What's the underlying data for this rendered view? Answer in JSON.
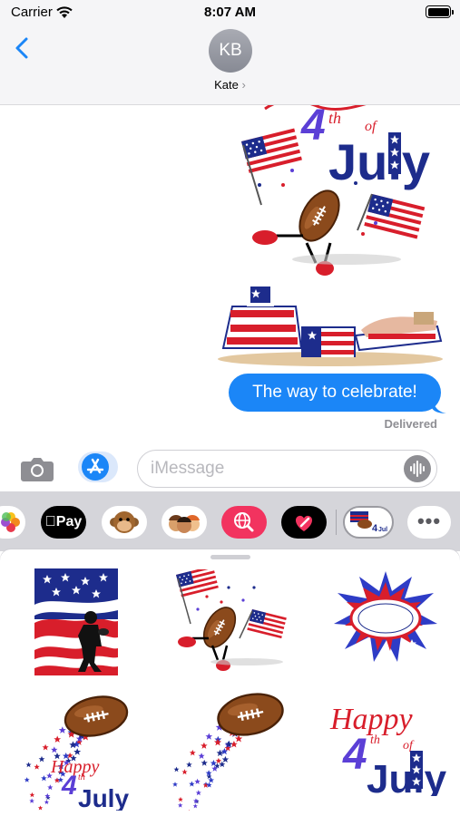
{
  "status_bar": {
    "carrier": "Carrier",
    "time": "8:07 AM",
    "wifi_icon": "wifi-icon",
    "battery_icon": "battery-icon"
  },
  "header": {
    "back_icon": "chevron-left-icon",
    "avatar_initials": "KB",
    "contact_name": "Kate",
    "contact_chevron": "›"
  },
  "messages": {
    "stickers": [
      "happy-4th-of-july-football-sticker",
      "patriotic-beach-chairs-sticker"
    ],
    "bubble_text": "The way to celebrate!",
    "status": "Delivered"
  },
  "input_bar": {
    "camera_icon": "camera-icon",
    "appstore_icon": "app-store-icon",
    "placeholder": "iMessage",
    "audio_icon": "audio-waveform-icon"
  },
  "app_strip": {
    "items": [
      "photos",
      "apple-pay",
      "animoji",
      "memoji",
      "web-images",
      "digital-touch",
      "sticker-pack",
      "more"
    ],
    "apple_pay_label": "Pay",
    "more_label": "•••"
  },
  "sticker_drawer": {
    "stickers": [
      "flag-football-player",
      "dancing-football-flags",
      "football-star-burst",
      "football-stars-happy-4th-july",
      "football-stars-trail",
      "happy-4th-of-july-text"
    ],
    "sticker_text": {
      "happy": "Happy",
      "four": "4",
      "th": "th",
      "of": "of",
      "july": "July"
    }
  },
  "colors": {
    "imessage_blue": "#1b86f7",
    "app_strip_bg": "#d5d5da",
    "flag_red": "#d81e2b",
    "flag_blue": "#1d2c8c",
    "football_brown": "#8b4a1c"
  }
}
